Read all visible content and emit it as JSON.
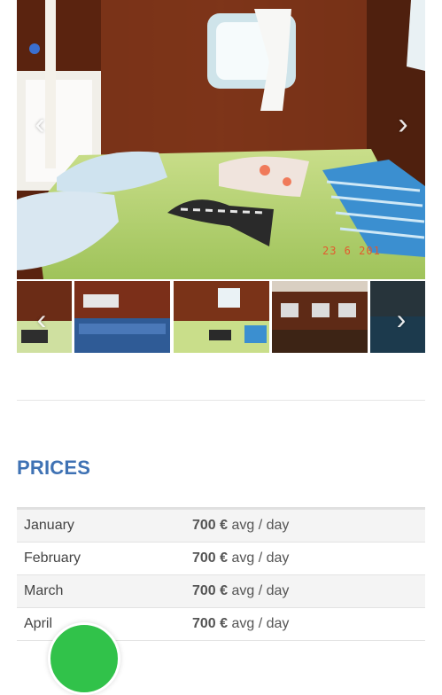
{
  "gallery": {
    "main_image_alt": "cabin-bedroom-photo",
    "date_stamp": "23  6 201",
    "prev_arrow": "‹",
    "next_arrow": "›",
    "thumbnails": [
      "cabin-thumb",
      "salon-thumb",
      "bedroom-thumb",
      "interior-thumb",
      "sea-thumb"
    ]
  },
  "prices": {
    "title": "PRICES",
    "rows": [
      {
        "month": "January",
        "amount": "700 €",
        "unit": "avg / day"
      },
      {
        "month": "February",
        "amount": "700 €",
        "unit": "avg / day"
      },
      {
        "month": "March",
        "amount": "700 €",
        "unit": "avg / day"
      },
      {
        "month": "April",
        "amount": "700 €",
        "unit": "avg / day"
      }
    ]
  },
  "colors": {
    "accent": "#3f72b4",
    "chat_button": "#31c24a"
  }
}
